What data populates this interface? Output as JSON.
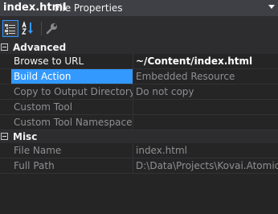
{
  "header": {
    "file_name": "index.html",
    "object_type": "File Properties"
  },
  "toolbar": {
    "buttons": [
      {
        "name": "categorized-view",
        "active": true
      },
      {
        "name": "alphabetical-view",
        "active": false
      },
      {
        "name": "property-pages",
        "active": false
      }
    ]
  },
  "categories": [
    {
      "label": "Advanced",
      "expanded": true,
      "properties": [
        {
          "name": "Browse to URL",
          "value": "~/Content/index.html",
          "name_style": "editable",
          "value_style": "bold",
          "selected": false
        },
        {
          "name": "Build Action",
          "value": "Embedded Resource",
          "name_style": "editable",
          "value_style": "readonly",
          "selected": true
        },
        {
          "name": "Copy to Output Directory",
          "value": "Do not copy",
          "name_style": "readonly",
          "value_style": "readonly",
          "selected": false
        },
        {
          "name": "Custom Tool",
          "value": "",
          "name_style": "readonly",
          "value_style": "readonly",
          "selected": false
        },
        {
          "name": "Custom Tool Namespace",
          "value": "",
          "name_style": "readonly",
          "value_style": "readonly",
          "selected": false
        }
      ]
    },
    {
      "label": "Misc",
      "expanded": true,
      "properties": [
        {
          "name": "File Name",
          "value": "index.html",
          "name_style": "readonly",
          "value_style": "readonly",
          "selected": false
        },
        {
          "name": "Full Path",
          "value": "D:\\Data\\Projects\\Kovai.AtomicSc",
          "name_style": "readonly",
          "value_style": "readonly",
          "selected": false
        }
      ]
    }
  ],
  "colors": {
    "background": "#252526",
    "header": "#3f3f46",
    "toolbar": "#2d2d30",
    "selection": "#3399ff",
    "readonly_text": "#8f8f93",
    "text": "#f1f1f1"
  }
}
